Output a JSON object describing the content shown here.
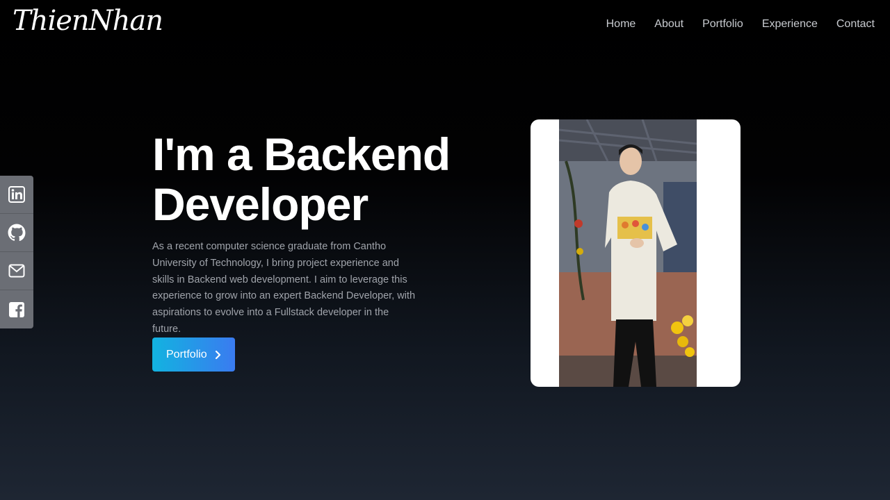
{
  "brand": {
    "logo_text": "ThienNhan"
  },
  "nav": {
    "items": [
      {
        "label": "Home"
      },
      {
        "label": "About"
      },
      {
        "label": "Portfolio"
      },
      {
        "label": "Experience"
      },
      {
        "label": "Contact"
      }
    ]
  },
  "social": {
    "items": [
      {
        "icon": "linkedin-icon"
      },
      {
        "icon": "github-icon"
      },
      {
        "icon": "mail-icon"
      },
      {
        "icon": "facebook-icon"
      }
    ]
  },
  "hero": {
    "title_line1": "I'm a Backend",
    "title_line2": "Developer",
    "description": "As a recent computer science graduate from Cantho University of Technology, I bring project experience and skills in Backend web development. I aim to leverage this experience to grow into an expert Backend Developer, with aspirations to evolve into a Fullstack developer in the future.",
    "cta_label": "Portfolio",
    "cta_icon": "chevron-right-icon"
  },
  "colors": {
    "accent_start": "#12b3e0",
    "accent_end": "#3a7bf0",
    "social_bg": "#6b6e75"
  }
}
